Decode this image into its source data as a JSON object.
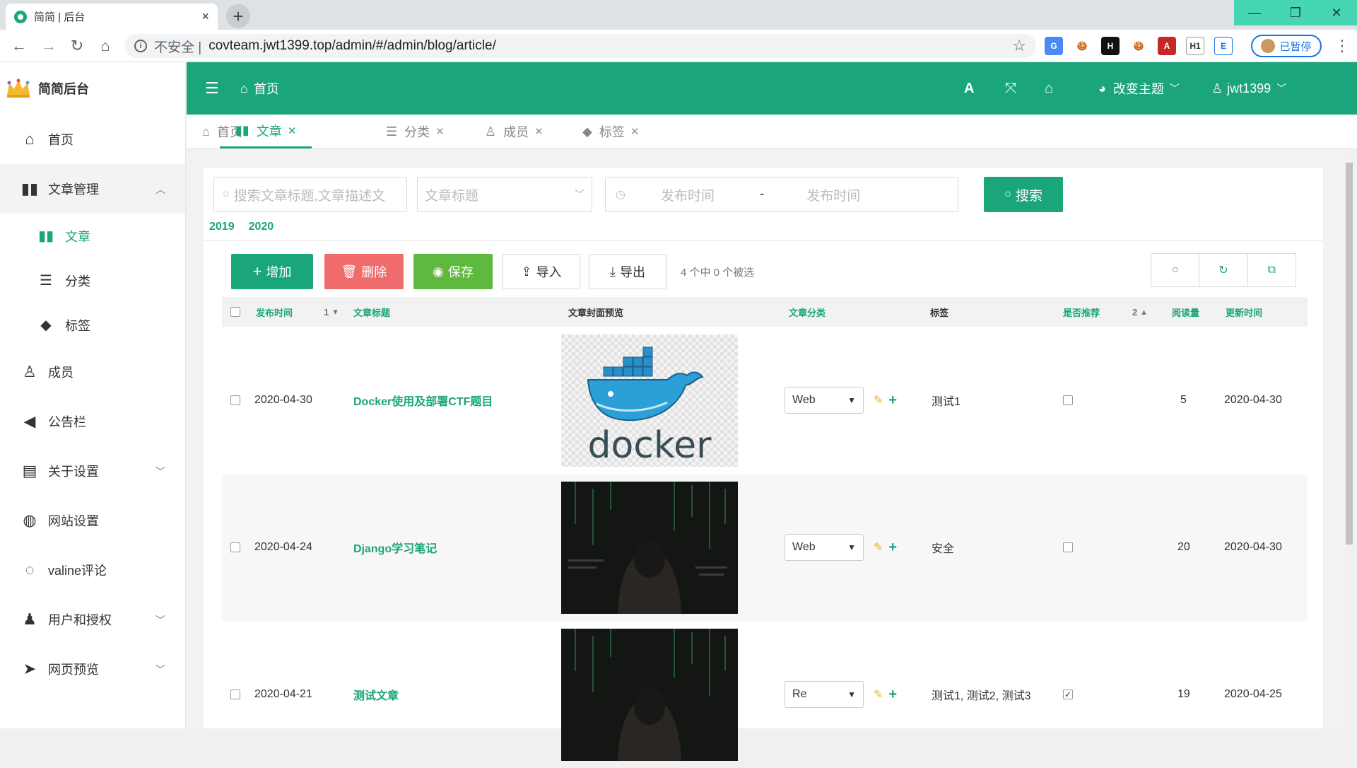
{
  "browser": {
    "tab_title": "简简 | 后台",
    "tab_close": "×",
    "new_tab": "+",
    "insecure_label": "不安全",
    "url": "covteam.jwt1399.top/admin/#/admin/blog/article/",
    "paused_label": "已暂停",
    "window_controls": [
      "—",
      "❐",
      "✕"
    ],
    "extensions": [
      "G",
      "🍪",
      "H",
      "🍪",
      "A",
      "H1",
      "E"
    ]
  },
  "sidebar": {
    "brand": "简简后台",
    "items": [
      {
        "icon": "home-icon",
        "glyph": "🏠",
        "label": "首页"
      },
      {
        "icon": "book-icon",
        "glyph": "📖",
        "label": "文章管理",
        "open": true
      },
      {
        "icon": "user-icon",
        "glyph": "👤",
        "label": "成员"
      },
      {
        "icon": "megaphone-icon",
        "glyph": "📢",
        "label": "公告栏"
      },
      {
        "icon": "id-card-icon",
        "glyph": "🪪",
        "label": "关于设置",
        "chevron": true
      },
      {
        "icon": "globe-icon",
        "glyph": "🌐",
        "label": "网站设置"
      },
      {
        "icon": "comments-icon",
        "glyph": "💬",
        "label": "valine评论"
      },
      {
        "icon": "user-shield-icon",
        "glyph": "👥",
        "label": "用户和授权",
        "chevron": true
      },
      {
        "icon": "paper-plane-icon",
        "glyph": "✈",
        "label": "网页预览",
        "chevron": true
      }
    ],
    "submenu": [
      {
        "label": "文章",
        "active": true
      },
      {
        "label": "分类"
      },
      {
        "label": "标签"
      }
    ]
  },
  "topbar": {
    "menu_icon": "☰",
    "home": "首页",
    "theme": "改变主题",
    "user": "jwt1399"
  },
  "page_tabs": [
    {
      "label": "首页",
      "icon": "home-icon",
      "glyph": "🏠"
    },
    {
      "label": "文章",
      "icon": "book-icon",
      "glyph": "📖",
      "active": true,
      "closable": true
    },
    {
      "label": "分类",
      "icon": "list-icon",
      "glyph": "☰",
      "closable": true
    },
    {
      "label": "成员",
      "icon": "user-icon",
      "glyph": "👤",
      "closable": true
    },
    {
      "label": "标签",
      "icon": "tags-icon",
      "glyph": "🏷",
      "closable": true
    }
  ],
  "search": {
    "keyword_placeholder": "搜索文章标题,文章描述文",
    "title_select_placeholder": "文章标题",
    "date_start_placeholder": "发布时间",
    "date_sep": "-",
    "date_end_placeholder": "发布时间",
    "button": "搜索"
  },
  "years": [
    "2019",
    "2020"
  ],
  "toolbar": {
    "add": "增加",
    "delete": "删除",
    "save": "保存",
    "import": "导入",
    "export": "导出",
    "selection": "4 个中 0 个被选"
  },
  "table": {
    "headers": {
      "published": "发布时间",
      "published_sort": "1",
      "title": "文章标题",
      "cover": "文章封面预览",
      "category": "文章分类",
      "tags": "标签",
      "recommended": "是否推荐",
      "recommended_sort": "2",
      "views": "阅读量",
      "updated": "更新时间"
    },
    "rows": [
      {
        "published": "2020-04-30",
        "title": "Docker使用及部署CTF题目",
        "cover": "docker",
        "category": "Web",
        "tags": "测试1",
        "recommended": false,
        "views": "5",
        "updated": "2020-04-30"
      },
      {
        "published": "2020-04-24",
        "title": "Django学习笔记",
        "cover": "hacker",
        "category": "Web",
        "tags": "安全",
        "recommended": false,
        "views": "20",
        "updated": "2020-04-30"
      },
      {
        "published": "2020-04-21",
        "title": "测试文章",
        "cover": "hacker",
        "category": "Re",
        "tags": "测试1, 测试2, 测试3",
        "recommended": true,
        "views": "19",
        "updated": "2020-04-25"
      }
    ]
  },
  "colors": {
    "primary": "#1ba57a",
    "danger": "#f06b6b",
    "success": "#5fb93e"
  }
}
